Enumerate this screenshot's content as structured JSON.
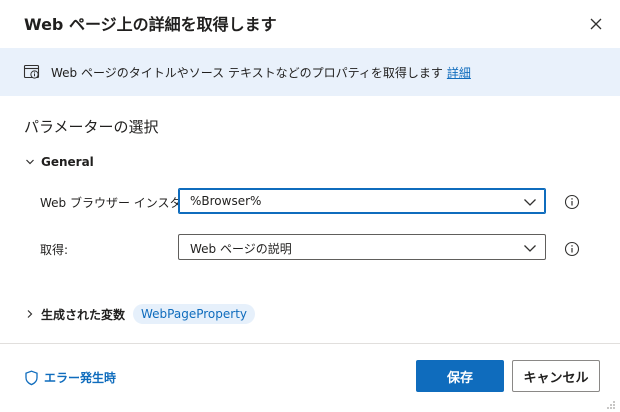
{
  "dialog": {
    "title": "Web ページ上の詳細を取得します"
  },
  "info": {
    "text": "Web ページのタイトルやソース テキストなどのプロパティを取得します",
    "link_label": "詳細"
  },
  "parameters": {
    "section_title": "パラメーターの選択",
    "group_label": "General",
    "fields": [
      {
        "label": "Web ブラウザー インスタンス:",
        "value": "%Browser%"
      },
      {
        "label": "取得:",
        "value": "Web ページの説明"
      }
    ]
  },
  "variables": {
    "label": "生成された変数",
    "chip": "WebPageProperty"
  },
  "footer": {
    "error_link": "エラー発生時",
    "save_label": "保存",
    "cancel_label": "キャンセル"
  },
  "colors": {
    "accent": "#0f6cbd",
    "info_background": "#e9f1fb",
    "chip_background": "#e6f0fb"
  }
}
